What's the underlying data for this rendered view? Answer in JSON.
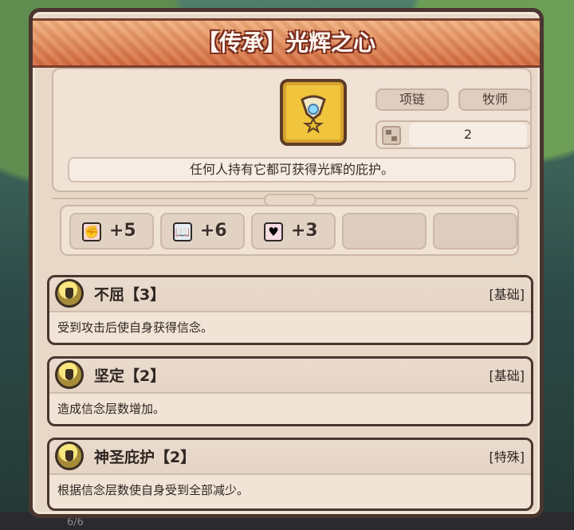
{
  "item": {
    "title": "【传承】光辉之心",
    "type_tag": "项链",
    "class_tag": "牧师",
    "capacity": "2",
    "description": "任何人持有它都可获得光辉的庇护。",
    "icon": "necklace-icon"
  },
  "stats": [
    {
      "icon": "fist-icon",
      "value": "+5"
    },
    {
      "icon": "book-icon",
      "value": "+6"
    },
    {
      "icon": "heart-icon",
      "value": "+3"
    }
  ],
  "skills": [
    {
      "name": "不屈【3】",
      "tag": "[基础]",
      "description": "受到攻击后使自身获得信念。"
    },
    {
      "name": "坚定【2】",
      "tag": "[基础]",
      "description": "造成信念层数增加。"
    },
    {
      "name": "神圣庇护【2】",
      "tag": "[特殊]",
      "description": "根据信念层数使自身受到全部减少。"
    }
  ],
  "footer": {
    "count": "6/6"
  },
  "colors": {
    "panel": "#e7d8c8",
    "title_bar": "#d56a3e",
    "border": "#4a352f",
    "accent_gold": "#f0c43c"
  }
}
